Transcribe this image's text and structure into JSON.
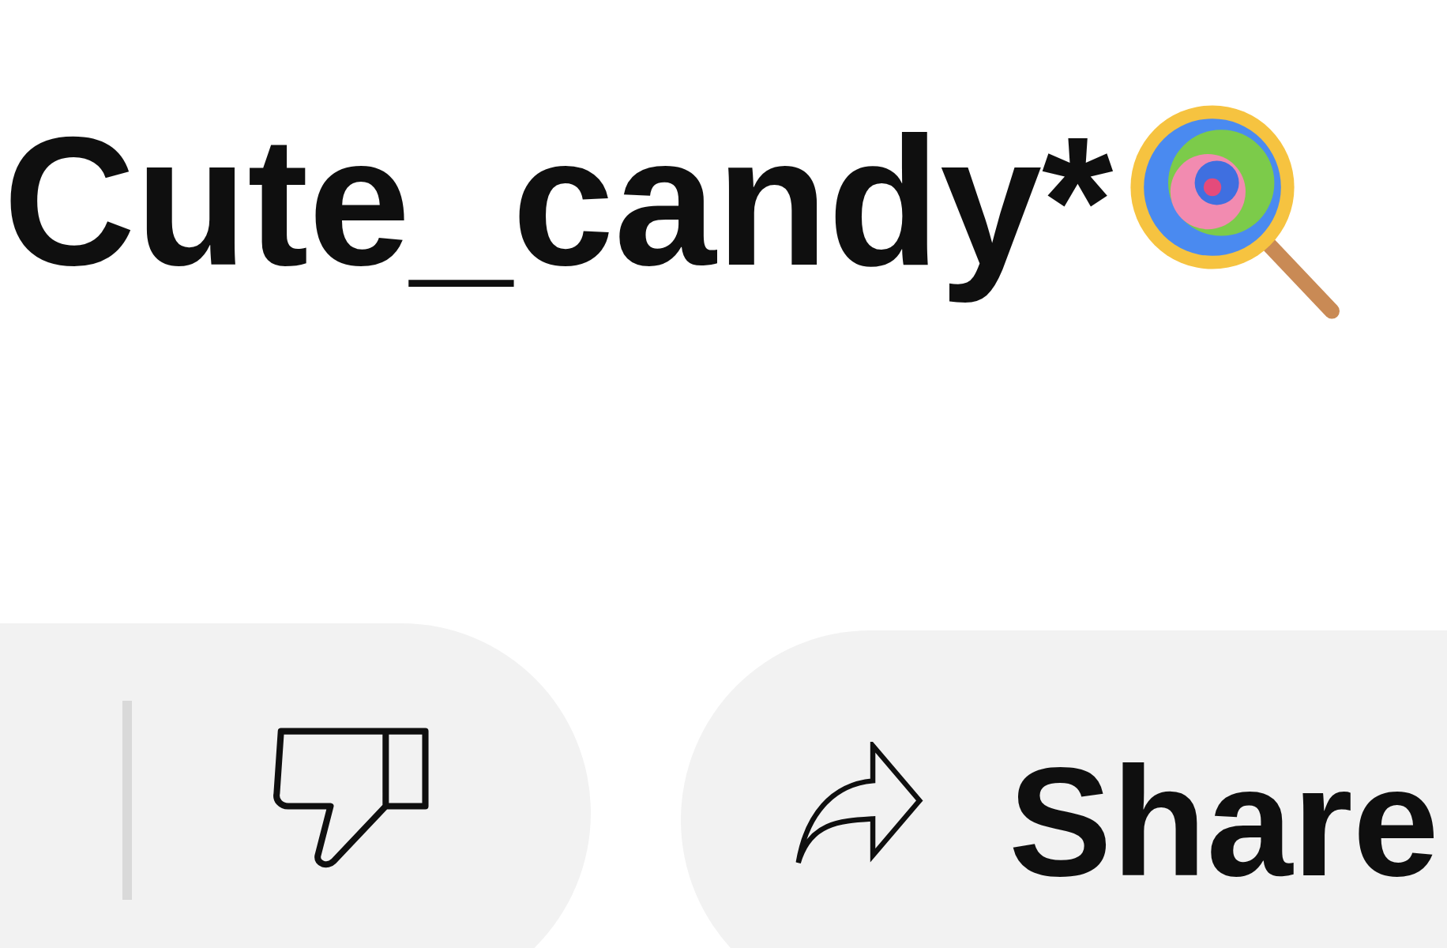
{
  "title": {
    "text": "Cute_candy*"
  },
  "actions": [
    {
      "kind": "dislike"
    },
    {
      "kind": "share",
      "label": "Share"
    }
  ]
}
